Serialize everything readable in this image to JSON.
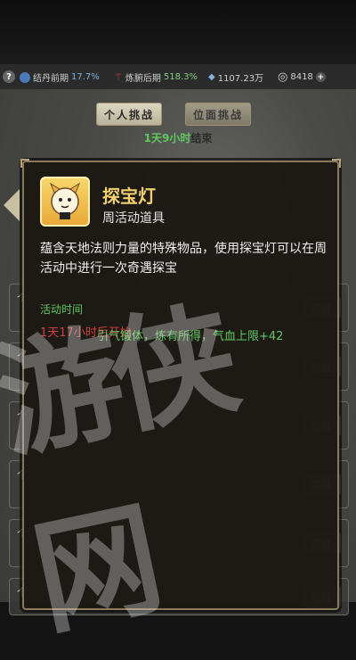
{
  "status_bar": {
    "help": "?",
    "realm_label": "结丹前期",
    "realm_pct": "17.7%",
    "body_label": "炼腑后期",
    "body_pct": "518.3%",
    "resource_amount": "1107.23万",
    "gold_amount": "8418",
    "add": "+"
  },
  "tabs": {
    "personal": "个人挑战",
    "realm": "位面挑战"
  },
  "timer": {
    "green": "1天9小时",
    "suffix": "结束"
  },
  "list_rows": [
    {
      "label": "个",
      "button": "前往"
    },
    {
      "label": "个",
      "button": "前往"
    },
    {
      "label": "个",
      "button": "前往"
    },
    {
      "label": "个",
      "button": "前往"
    },
    {
      "label": "个",
      "button": "前往"
    },
    {
      "label": "个",
      "button": "前往"
    }
  ],
  "popup": {
    "name": "探宝灯",
    "type": "周活动道具",
    "description": "蕴含天地法则力量的特殊物品，使用探宝灯可以在周活动中进行一次奇遇探宝",
    "section_title": "活动时间",
    "red_text": "1天17小时后开始",
    "green_text": "引气锻体，炼有所得，气血上限+42"
  },
  "watermark": "游侠网",
  "colors": {
    "item_name": "#f0d070",
    "green": "#5ec95e",
    "red": "#d04040"
  }
}
